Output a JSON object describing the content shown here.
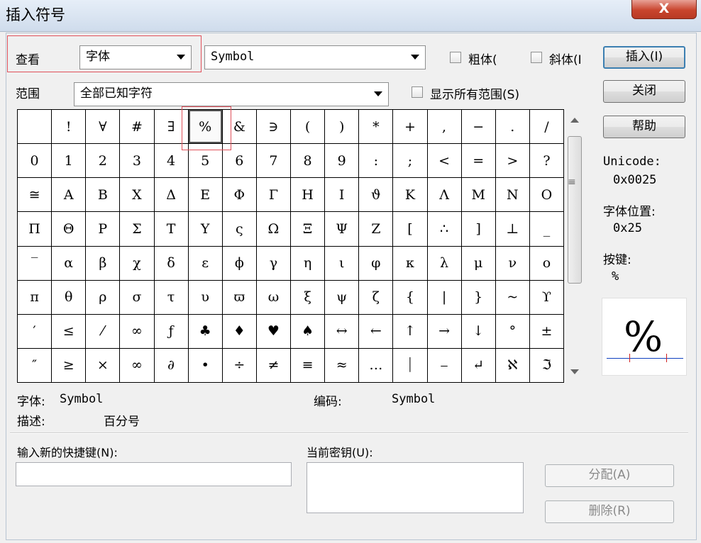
{
  "window": {
    "title": "插入符号",
    "close_label": "X"
  },
  "view": {
    "label": "查看",
    "selected": "字体"
  },
  "font": {
    "selected": "Symbol"
  },
  "bold": {
    "label": "粗体("
  },
  "italic": {
    "label": "斜体(I"
  },
  "range": {
    "label": "范围",
    "selected": "全部已知字符"
  },
  "show_all_ranges": {
    "label": "显示所有范围(S)"
  },
  "buttons": {
    "insert": "插入(I)",
    "close": "关闭",
    "help": "帮助",
    "assign": "分配(A)",
    "delete": "删除(R)"
  },
  "grid": {
    "selected_index": 5,
    "cells": [
      "",
      "!",
      "∀",
      "#",
      "∃",
      "%",
      "&",
      "∋",
      "(",
      ")",
      "*",
      "+",
      ",",
      "−",
      ".",
      "/",
      "0",
      "1",
      "2",
      "3",
      "4",
      "5",
      "6",
      "7",
      "8",
      "9",
      ":",
      ";",
      "<",
      "=",
      ">",
      "?",
      "≅",
      "Α",
      "Β",
      "Χ",
      "Δ",
      "Ε",
      "Φ",
      "Γ",
      "Η",
      "Ι",
      "ϑ",
      "Κ",
      "Λ",
      "Μ",
      "Ν",
      "Ο",
      "Π",
      "Θ",
      "Ρ",
      "Σ",
      "Τ",
      "Υ",
      "ς",
      "Ω",
      "Ξ",
      "Ψ",
      "Ζ",
      "[",
      "∴",
      "]",
      "⊥",
      "_",
      "‾",
      "α",
      "β",
      "χ",
      "δ",
      "ε",
      "ϕ",
      "γ",
      "η",
      "ι",
      "φ",
      "κ",
      "λ",
      "μ",
      "ν",
      "ο",
      "π",
      "θ",
      "ρ",
      "σ",
      "τ",
      "υ",
      "ϖ",
      "ω",
      "ξ",
      "ψ",
      "ζ",
      "{",
      "|",
      "}",
      "~",
      "ϒ",
      "′",
      "≤",
      "⁄",
      "∞",
      "ƒ",
      "♣",
      "♦",
      "♥",
      "♠",
      "↔",
      "←",
      "↑",
      "→",
      "↓",
      "°",
      "±",
      "″",
      "≥",
      "×",
      "∞",
      "∂",
      "•",
      "÷",
      "≠",
      "≡",
      "≈",
      "…",
      "⏐",
      "⎯",
      "↵",
      "ℵ",
      "ℑ"
    ]
  },
  "info": {
    "unicode_label": "Unicode:",
    "unicode_value": "0x0025",
    "font_pos_label": "字体位置:",
    "font_pos_value": "0x25",
    "key_label": "按键:",
    "key_value": "%",
    "preview_char": "%"
  },
  "details": {
    "font_label": "字体:",
    "font_value": "Symbol",
    "encoding_label": "编码:",
    "encoding_value": "Symbol",
    "desc_label": "描述:",
    "desc_value": "百分号"
  },
  "shortcut": {
    "new_label": "输入新的快捷键(N):",
    "current_label": "当前密钥(U):"
  }
}
